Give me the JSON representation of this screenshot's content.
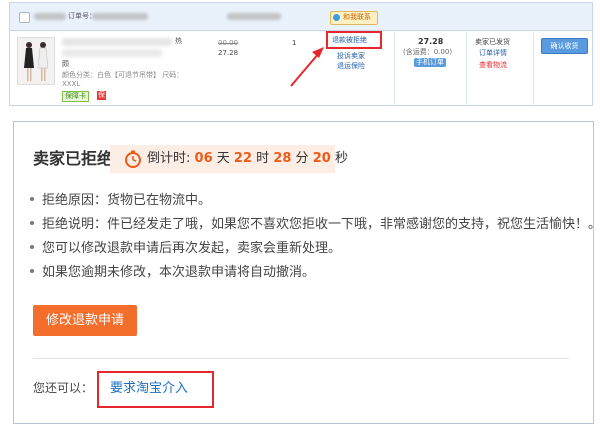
{
  "order": {
    "order_no_label": "订单号：",
    "badge": "和我联系",
    "product": {
      "name_tail": "热",
      "subtitle": "颇",
      "attrs_prefix": "颜色分类：白色【可退节吊带】 尺码：",
      "size": "XXXL",
      "tag_green": "保障卡",
      "tag_red": "保"
    },
    "price_original": "00.00",
    "price_now": "27.28",
    "quantity": "1",
    "actions_top": "退款被拒绝",
    "actions": [
      "投诉卖家",
      "退运保险"
    ],
    "total": "27.28",
    "shipping": "(含运费：0.00)",
    "pay_tag": "手机订单",
    "status": [
      "卖家已发货",
      "订单详情"
    ],
    "logistics_link": "查看物流",
    "confirm_button": "确认收货"
  },
  "refund": {
    "title": "卖家已拒绝",
    "countdown": {
      "prefix": "倒计时:",
      "days": "06",
      "day_unit": "天",
      "hours": "22",
      "hour_unit": "时",
      "minutes": "28",
      "minute_unit": "分",
      "seconds": "20",
      "second_unit": "秒"
    },
    "lines": [
      "拒绝原因：货物已在物流中。",
      "拒绝说明：件已经发走了哦，如果您不喜欢您拒收一下哦，非常感谢您的支持，祝您生活愉快！。",
      "您可以修改退款申请后再次发起，卖家会重新处理。",
      "如果您逾期未修改，本次退款申请将自动撤消。"
    ],
    "modify_button": "修改退款申请",
    "you_can": "您还可以：",
    "intervene_link": "要求淘宝介入"
  },
  "colors": {
    "orange": "#f36d2b",
    "countdown_accent": "#ee5a18",
    "link_blue": "#1a6fc2",
    "annotation_red": "#e8262d"
  }
}
